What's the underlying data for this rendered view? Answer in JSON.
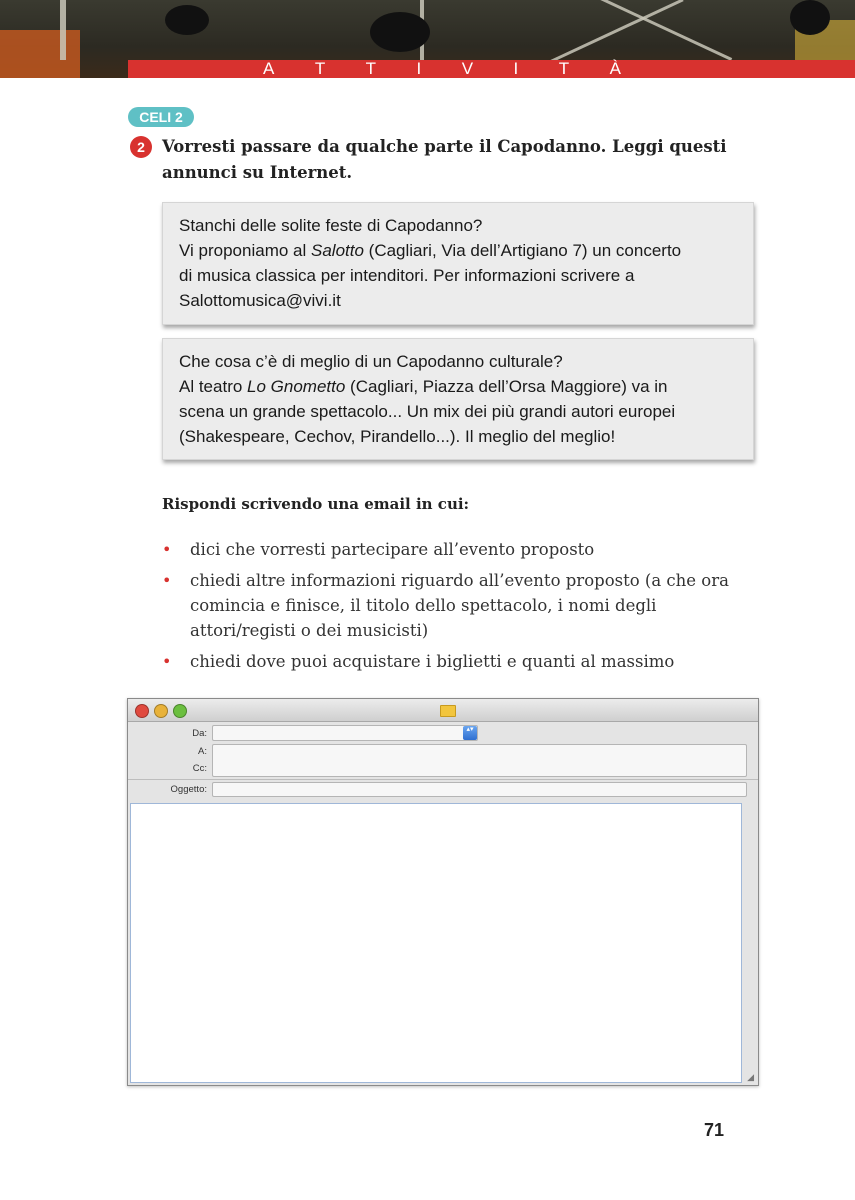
{
  "header": {
    "title_letters": [
      "A",
      "T",
      "T",
      "I",
      "V",
      "I",
      "T",
      "À"
    ]
  },
  "exercise": {
    "badge": "CELI 2",
    "number": "2",
    "instruction": "Vorresti passare da qualche parte il Capodanno. Leggi questi annunci su Internet."
  },
  "ads": [
    {
      "line1": "Stanchi delle solite feste di Capodanno?",
      "line2_pre": "Vi proponiamo al ",
      "line2_italic": "Salotto",
      "line2_post": " (Cagliari, Via dell’Artigiano 7) un concerto",
      "line3": "di musica classica per intenditori. Per informazioni scrivere a",
      "line4": "Salottomusica@vivi.it"
    },
    {
      "line1": "Che cosa c’è di meglio di un Capodanno culturale?",
      "line2_pre": "Al teatro ",
      "line2_italic": "Lo Gnometto",
      "line2_post": " (Cagliari, Piazza dell’Orsa Maggiore) va in",
      "line3": "scena un grande spettacolo... Un mix dei più grandi autori europei",
      "line4": "(Shakespeare, Cechov, Pirandello...). Il meglio del meglio!"
    }
  ],
  "task": {
    "heading": "Rispondi scrivendo una email in cui:",
    "bullets": [
      "dici che vorresti partecipare all’evento proposto",
      "chiedi altre informazioni riguardo all’evento proposto (a che ora comincia e finisce, il titolo dello spettacolo, i nomi degli attori/registi o dei musicisti)",
      "chiedi dove puoi acquistare i biglietti e quanti al massimo"
    ],
    "bullet_mark": "•"
  },
  "mail": {
    "labels": {
      "from": "Da:",
      "to": "A:",
      "cc": "Cc:",
      "subject": "Oggetto:"
    },
    "values": {
      "from": "",
      "to": "",
      "cc": "",
      "subject": "",
      "body": ""
    },
    "select_arrows": "▴▾",
    "grip": "◢",
    "icon": "envelope-icon"
  },
  "page_number": "71",
  "colors": {
    "accent_red": "#d8322f",
    "badge_teal": "#5fc0c5"
  }
}
